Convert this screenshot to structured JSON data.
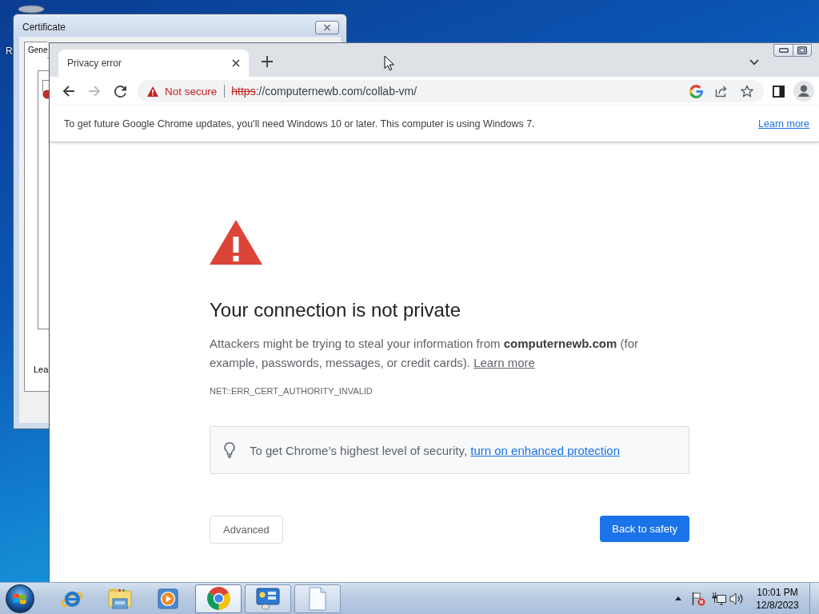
{
  "desktop": {
    "icon_label": "R"
  },
  "certificate_window": {
    "title": "Certificate",
    "tabs": [
      {
        "label": "Gene",
        "selected": true
      }
    ],
    "text": "Lea"
  },
  "browser": {
    "tabs": [
      {
        "title": "Privacy error",
        "selected": true
      }
    ],
    "toolbar": {
      "navigation": [
        {
          "kind": "back",
          "disabled": false
        },
        {
          "kind": "forward",
          "disabled": true
        }
      ]
    },
    "omnibox": {
      "security_label": "Not secure",
      "url_scheme": "https",
      "url_rest": "://computernewb.com/collab-vm/"
    },
    "infobar": {
      "message": "To get future Google Chrome updates, you'll need Windows 10 or later. This computer is using Windows 7.",
      "link": "Learn more"
    },
    "page": {
      "heading": "Your connection is not private",
      "body": "Attackers might be trying to steal your information from **computernewb.com** (for example, passwords, messages, or credit cards).",
      "body_link": "Learn more",
      "error_code": "NET::ERR_CERT_AUTHORITY_INVALID",
      "tip": "To get Chrome’s highest level of security,",
      "tip_link": "turn on enhanced protection",
      "buttons": [
        {
          "label": "Advanced",
          "kind": "secondary"
        },
        {
          "label": "Back to safety",
          "kind": "primary"
        }
      ]
    }
  },
  "taskbar": {
    "items": [
      {
        "kind": "pinned",
        "active": false
      },
      {
        "kind": "pinned",
        "active": false
      },
      {
        "kind": "pinned",
        "active": false
      },
      {
        "kind": "running",
        "active": true
      },
      {
        "kind": "running",
        "active": false
      },
      {
        "kind": "running",
        "active": false
      }
    ],
    "clock": {
      "time": "10:01 PM",
      "date": "12/8/2023"
    }
  }
}
